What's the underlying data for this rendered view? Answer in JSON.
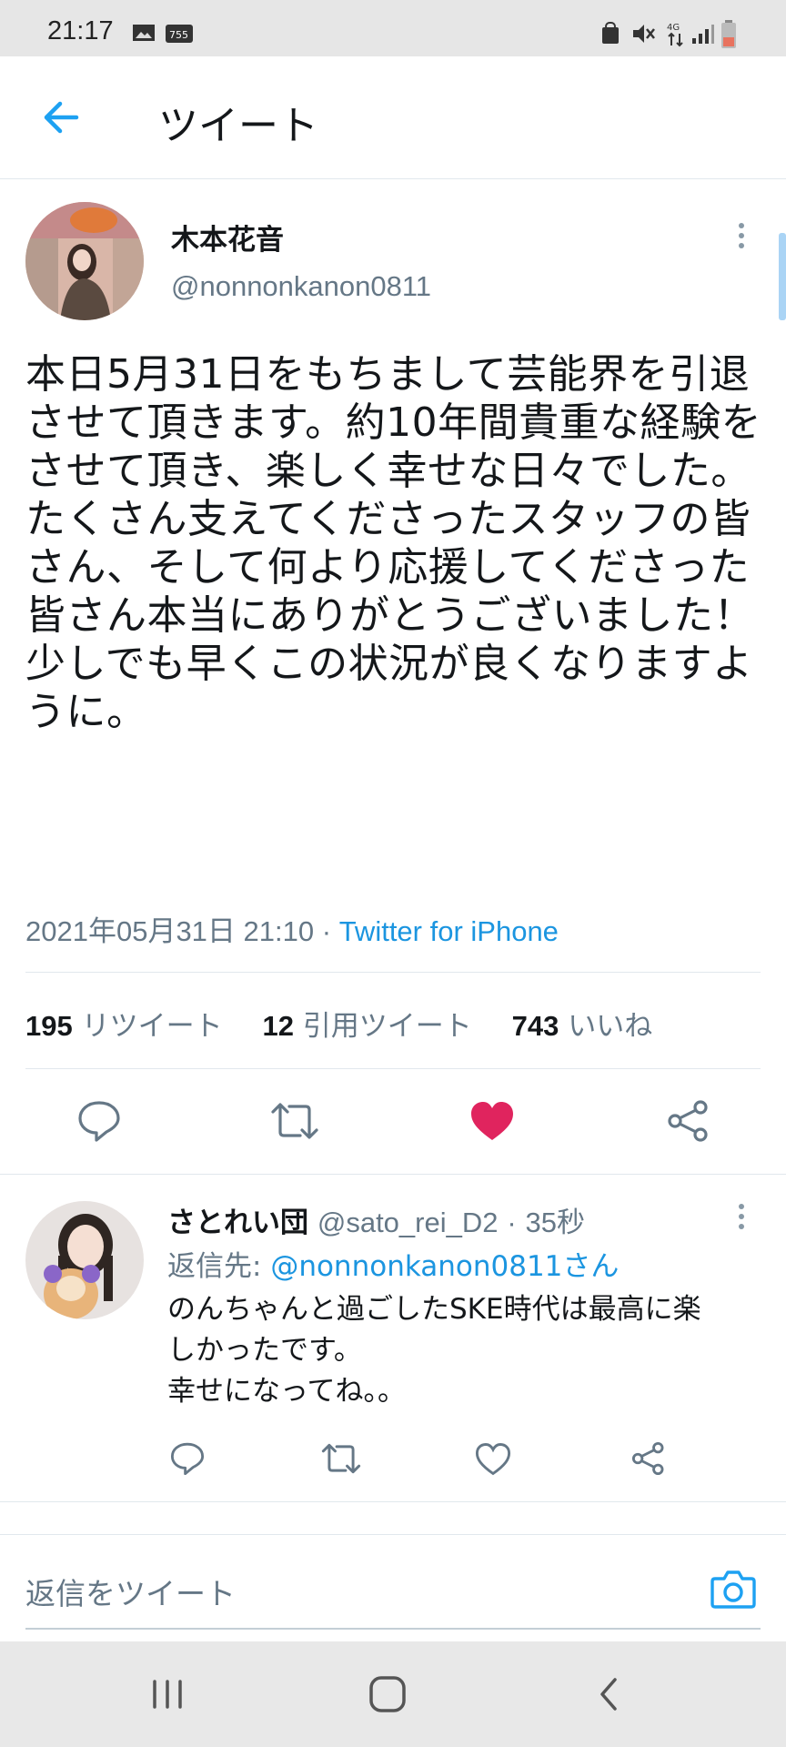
{
  "status_bar": {
    "time": "21:17",
    "icons": [
      "image-icon",
      "app-badge-icon",
      "recycle-lock-icon",
      "mute-icon",
      "4g-icon",
      "signal-icon",
      "battery-icon"
    ]
  },
  "header": {
    "title": "ツイート"
  },
  "tweet": {
    "display_name": "木本花音",
    "handle": "@nonnonkanon0811",
    "text": "本日5月31日をもちまして芸能界を引退させて頂きます。約10年間貴重な経験をさせて頂き、楽しく幸せな日々でした。たくさん支えてくださったスタッフの皆さん、そして何より応援してくださった皆さん本当にありがとうございました！少しでも早くこの状況が良くなりますように。",
    "timestamp": "2021年05月31日 21:10",
    "separator": "·",
    "source": "Twitter for iPhone",
    "stats": {
      "retweets_count": "195",
      "retweets_label": "リツイート",
      "quotes_count": "12",
      "quotes_label": "引用ツイート",
      "likes_count": "743",
      "likes_label": "いいね"
    }
  },
  "reply": {
    "display_name": "さとれい団",
    "handle": "@sato_rei_D2",
    "separator": "·",
    "time": "35秒",
    "reply_to_label": "返信先: ",
    "reply_to_handle": "@nonnonkanon0811さん",
    "text_lines": [
      "のんちゃんと過ごしたSKE時代は最高に楽",
      "しかったです。",
      "幸せになってね。。"
    ]
  },
  "compose": {
    "placeholder": "返信をツイート"
  },
  "colors": {
    "accent": "#1da1f2",
    "like": "#e0245e",
    "secondary": "#657786",
    "divider": "#e1e8ed"
  }
}
